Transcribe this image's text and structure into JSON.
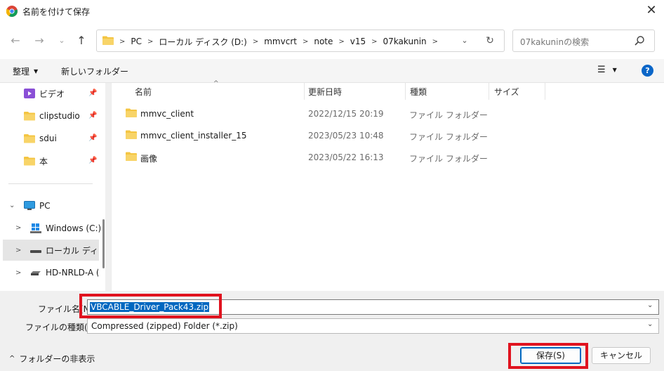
{
  "window": {
    "title": "名前を付けて保存",
    "close_glyph": "✕"
  },
  "nav": {
    "back": "←",
    "forward": "→",
    "history": "⌄",
    "up": "↑"
  },
  "address": {
    "crumbs": [
      "PC",
      "ローカル ディスク (D:)",
      "mmvcrt",
      "note",
      "v15",
      "07kakunin"
    ],
    "dropdown": "⌄",
    "refresh": "↻"
  },
  "search": {
    "placeholder": "07kakuninの検索"
  },
  "toolbar": {
    "organize_label": "整理",
    "new_folder_label": "新しいフォルダー",
    "view_glyph": "☰",
    "help_glyph": "?"
  },
  "sidebar": {
    "items": [
      {
        "label": "ビデオ",
        "icon": "video-folder-icon",
        "pinned": true
      },
      {
        "label": "clipstudio",
        "icon": "folder-icon",
        "pinned": true
      },
      {
        "label": "sdui",
        "icon": "folder-icon",
        "pinned": true
      },
      {
        "label": "本",
        "icon": "folder-icon",
        "pinned": true
      },
      {
        "label": "PC",
        "icon": "pc-icon",
        "expanded": true
      },
      {
        "label": "Windows (C:)",
        "icon": "windows-drive-icon"
      },
      {
        "label": "ローカル ディスク",
        "icon": "disk-drive-icon",
        "selected": true
      },
      {
        "label": "HD-NRLD-A (",
        "icon": "external-drive-icon"
      }
    ]
  },
  "filelist": {
    "columns": {
      "name": "名前",
      "date": "更新日時",
      "type": "種類",
      "size": "サイズ"
    },
    "rows": [
      {
        "name": "mmvc_client",
        "date": "2022/12/15 20:19",
        "type": "ファイル フォルダー"
      },
      {
        "name": "mmvc_client_installer_15",
        "date": "2023/05/23 10:48",
        "type": "ファイル フォルダー"
      },
      {
        "name": "画像",
        "date": "2023/05/22 16:13",
        "type": "ファイル フォルダー"
      }
    ]
  },
  "form": {
    "filename_label": "ファイル名(N):",
    "filename_value": "VBCABLE_Driver_Pack43.zip",
    "filetype_label": "ファイルの種類(T):",
    "filetype_value": "Compressed (zipped) Folder (*.zip)"
  },
  "footer": {
    "hide_folders_label": "フォルダーの非表示",
    "save_label": "保存(S)",
    "cancel_label": "キャンセル"
  },
  "colors": {
    "accent": "#0067c0",
    "highlight_box": "#e0131f",
    "folder": "#f4c542"
  }
}
